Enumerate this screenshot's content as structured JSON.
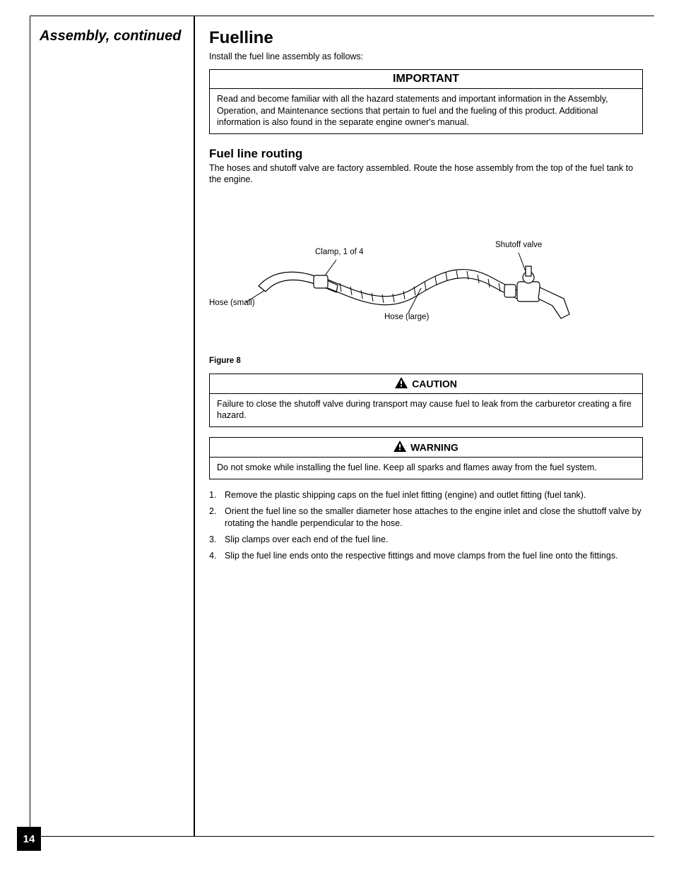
{
  "left": {
    "title": "Assembly, continued"
  },
  "main": {
    "heading": "Fuelline",
    "intro": "Install the fuel line assembly as follows:",
    "important": {
      "header": "IMPORTANT",
      "body": "Read and become familiar with all the hazard statements and important information in the Assembly, Operation, and Maintenance sections that pertain to fuel and the fueling of this product. Additional information is also found in the separate engine owner's manual."
    },
    "sub": "Fuel line routing",
    "sub_intro": "The hoses and shutoff valve are factory assembled. Route the hose assembly from the top of the fuel tank to the engine.",
    "callouts": {
      "a": "Hose (small)",
      "b": "Clamp, 1 of 4",
      "c": "Hose (large)",
      "d": "Shutoff valve"
    },
    "fig_caption": "Figure 8",
    "caution": {
      "header": "CAUTION",
      "body": "Failure to close the shutoff valve during transport may cause fuel to leak from the carburetor creating a fire hazard."
    },
    "warning": {
      "header": "WARNING",
      "body": "Do not smoke while installing the fuel line. Keep all sparks and flames away from the fuel system."
    },
    "steps_intro_hidden": "",
    "steps": [
      "Remove the plastic shipping caps on the fuel inlet fitting (engine) and outlet fitting (fuel tank).",
      "Orient the fuel line so the smaller diameter hose attaches to the engine inlet and close the shuttoff valve by rotating the handle perpendicular to the hose.",
      "Slip clamps over each end of the fuel line.",
      "Slip the fuel line ends onto the respective fittings and move clamps from the fuel line onto the fittings."
    ]
  },
  "page_number": "14"
}
